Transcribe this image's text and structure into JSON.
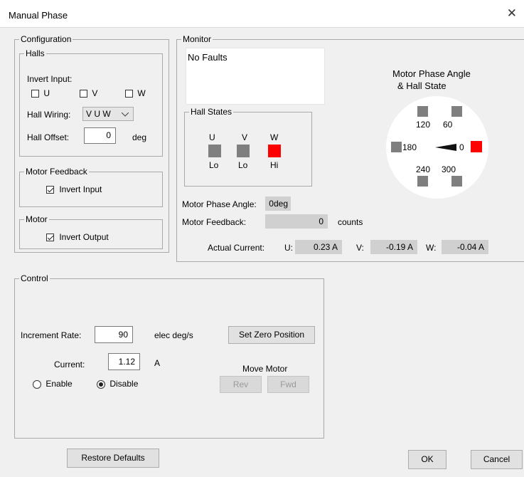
{
  "window": {
    "title": "Manual Phase",
    "close_glyph": "✕"
  },
  "configuration": {
    "legend": "Configuration",
    "halls": {
      "legend": "Halls",
      "invert_input_label": "Invert Input:",
      "checkboxes": [
        {
          "label": "U",
          "checked": false
        },
        {
          "label": "V",
          "checked": false
        },
        {
          "label": "W",
          "checked": false
        }
      ],
      "hall_wiring_label": "Hall Wiring:",
      "hall_wiring_value": "V U W",
      "hall_offset_label": "Hall Offset:",
      "hall_offset_value": "0",
      "hall_offset_unit": "deg"
    },
    "motor_feedback": {
      "legend": "Motor Feedback",
      "invert_input_label": "Invert Input",
      "checked": true
    },
    "motor": {
      "legend": "Motor",
      "invert_output_label": "Invert Output",
      "checked": true
    }
  },
  "monitor": {
    "legend": "Monitor",
    "faults_text": "No Faults",
    "hall_states": {
      "legend": "Hall States",
      "items": [
        {
          "name": "U",
          "state": "Lo",
          "active": false
        },
        {
          "name": "V",
          "state": "Lo",
          "active": false
        },
        {
          "name": "W",
          "state": "Hi",
          "active": true
        }
      ]
    },
    "dial": {
      "title_line1": "Motor Phase Angle",
      "title_line2": "& Hall State",
      "angle_labels": {
        "a0": "0",
        "a60": "60",
        "a120": "120",
        "a180": "180",
        "a240": "240",
        "a300": "300"
      }
    },
    "motor_phase_angle_label": "Motor Phase Angle:",
    "motor_phase_angle_value": "0deg",
    "motor_feedback_label": "Motor Feedback:",
    "motor_feedback_value": "0",
    "motor_feedback_unit": "counts",
    "actual_current_label": "Actual Current:",
    "currents": {
      "u_label": "U:",
      "u_value": "0.23 A",
      "v_label": "V:",
      "v_value": "-0.19 A",
      "w_label": "W:",
      "w_value": "-0.04 A"
    }
  },
  "control": {
    "legend": "Control",
    "increment_rate_label": "Increment Rate:",
    "increment_rate_value": "90",
    "increment_rate_unit": "elec deg/s",
    "set_zero_label": "Set Zero Position",
    "current_label": "Current:",
    "current_value": "1.12",
    "current_unit": "A",
    "enable_label": "Enable",
    "disable_label": "Disable",
    "selected": "Disable",
    "move_motor_label": "Move Motor",
    "rev_label": "Rev",
    "fwd_label": "Fwd"
  },
  "footer": {
    "restore_label": "Restore Defaults",
    "ok_label": "OK",
    "cancel_label": "Cancel"
  },
  "colors": {
    "hall_hi": "#ff0000",
    "hall_lo": "#7f7f7f",
    "readout_bg": "#d0d0d0"
  }
}
